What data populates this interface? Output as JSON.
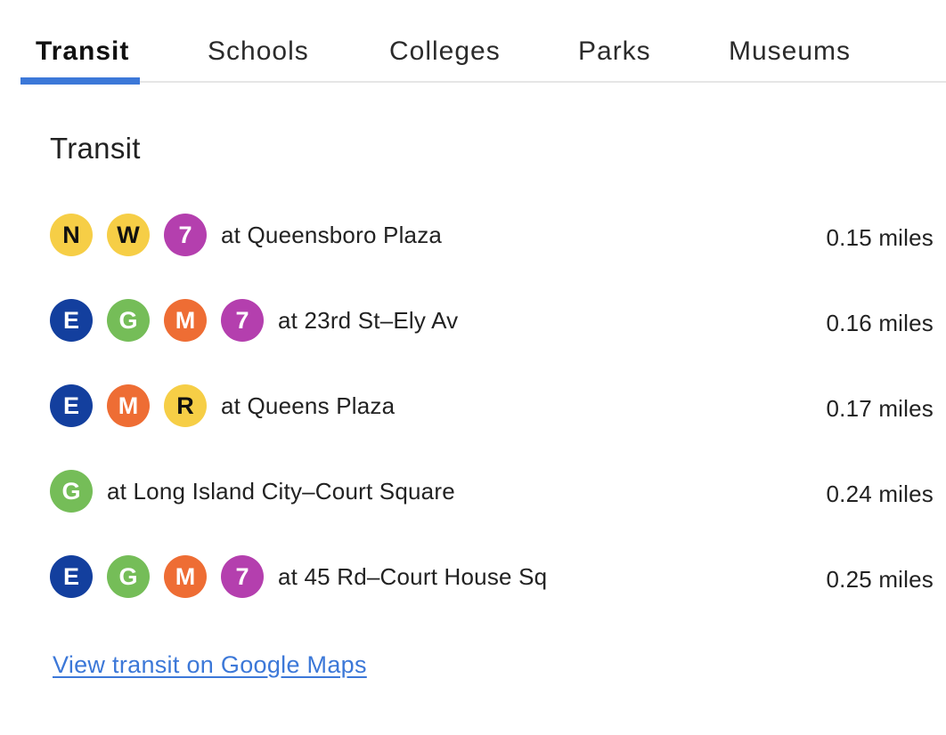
{
  "tabs": [
    {
      "label": "Transit",
      "active": true
    },
    {
      "label": "Schools",
      "active": false
    },
    {
      "label": "Colleges",
      "active": false
    },
    {
      "label": "Parks",
      "active": false
    },
    {
      "label": "Museums",
      "active": false
    }
  ],
  "section": {
    "title": "Transit"
  },
  "colors": {
    "accent": "#3c78d8",
    "line_yellow": "#f6ce46",
    "line_purple": "#b43fae",
    "line_blue": "#133f9e",
    "line_green": "#75bd58",
    "line_orange": "#ee6d34"
  },
  "routes": [
    {
      "lines": [
        {
          "label": "N",
          "color": "#f6ce46",
          "text_dark": true
        },
        {
          "label": "W",
          "color": "#f6ce46",
          "text_dark": true
        },
        {
          "label": "7",
          "color": "#b43fae",
          "text_dark": false
        }
      ],
      "station": "at Queensboro Plaza",
      "distance": "0.15 miles"
    },
    {
      "lines": [
        {
          "label": "E",
          "color": "#133f9e",
          "text_dark": false
        },
        {
          "label": "G",
          "color": "#75bd58",
          "text_dark": false
        },
        {
          "label": "M",
          "color": "#ee6d34",
          "text_dark": false
        },
        {
          "label": "7",
          "color": "#b43fae",
          "text_dark": false
        }
      ],
      "station": "at 23rd St–Ely Av",
      "distance": "0.16 miles"
    },
    {
      "lines": [
        {
          "label": "E",
          "color": "#133f9e",
          "text_dark": false
        },
        {
          "label": "M",
          "color": "#ee6d34",
          "text_dark": false
        },
        {
          "label": "R",
          "color": "#f6ce46",
          "text_dark": true
        }
      ],
      "station": "at Queens Plaza",
      "distance": "0.17 miles"
    },
    {
      "lines": [
        {
          "label": "G",
          "color": "#75bd58",
          "text_dark": false
        }
      ],
      "station": "at Long Island City–Court Square",
      "distance": "0.24 miles"
    },
    {
      "lines": [
        {
          "label": "E",
          "color": "#133f9e",
          "text_dark": false
        },
        {
          "label": "G",
          "color": "#75bd58",
          "text_dark": false
        },
        {
          "label": "M",
          "color": "#ee6d34",
          "text_dark": false
        },
        {
          "label": "7",
          "color": "#b43fae",
          "text_dark": false
        }
      ],
      "station": "at 45 Rd–Court House Sq",
      "distance": "0.25 miles"
    }
  ],
  "footer": {
    "maps_link": "View transit on Google Maps"
  }
}
